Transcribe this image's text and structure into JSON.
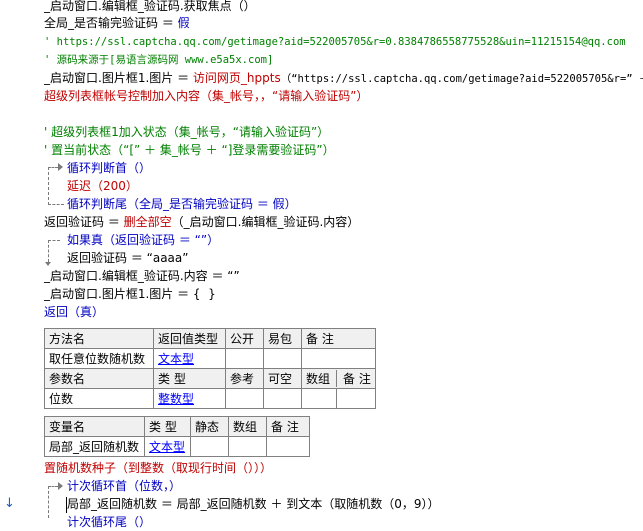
{
  "lines": {
    "l1": "_启动窗口.编辑框_验证码.获取焦点（）",
    "l2_a": "全局_是否输完验证码",
    "l2_b": " ＝ ",
    "l2_c": "假",
    "l3": "' https://ssl.captcha.qq.com/getimage?aid=522005705&r=0.8384786558775528&uin=11215154@qq.com",
    "l4": "' 源码来源于[易语言源码网 www.e5a5x.com]",
    "l5_a": "_启动窗口.图片框1.图片",
    "l5_b": " ＝ ",
    "l5_c": "访问网页_hppts",
    "l5_d": "（“https://ssl.captcha.qq.com/getimage?aid=522005705&r=” ＋",
    "l6": "超级列表框帐号控制加入内容（集_帐号，，“请输入验证码”）",
    "l7": "' 超级列表框1加入状态（集_帐号，“请输入验证码”）",
    "l8": "' 置当前状态（“[” ＋ 集_帐号 ＋ “]登录需要验证码”）",
    "l9": "循环判断首（）",
    "l10": "延迟（200）",
    "l11": "循环判断尾（全局_是否输完验证码 ＝ 假）",
    "l12_a": "返回验证码 ＝ ",
    "l12_b": "删全部空",
    "l12_c": "（_启动窗口.编辑框_验证码.内容）",
    "l13": "如果真（返回验证码 ＝ “”）",
    "l14": "返回验证码 ＝ “aaaa”",
    "l15": "_启动窗口.编辑框_验证码.内容 ＝ “”",
    "l16": "_启动窗口.图片框1.图片 ＝ {  }",
    "l17": "返回（真）",
    "l18": "置随机数种子（到整数（取现行时间（）））",
    "l19": "计次循环首（位数，）",
    "l20": "局部_返回随机数 ＝ 局部_返回随机数 ＋ 到文本（取随机数（0，9））",
    "l21": "计次循环尾（）"
  },
  "method_table": {
    "headers": [
      "方法名",
      "返回值类型",
      "公开",
      "易包",
      "备 注"
    ],
    "row": [
      "取任意位数随机数",
      "文本型",
      "",
      "",
      ""
    ]
  },
  "param_table": {
    "headers": [
      "参数名",
      "类 型",
      "参考",
      "可空",
      "数组",
      "备 注"
    ],
    "row": [
      "位数",
      "整数型",
      "",
      "",
      "",
      ""
    ]
  },
  "var_table": {
    "headers": [
      "变量名",
      "类 型",
      "静态",
      "数组",
      "备 注"
    ],
    "row": [
      "局部_返回随机数",
      "文本型",
      "",
      "",
      ""
    ]
  },
  "gutter_marker": "↓",
  "colors": {
    "keyword": "#0000c0",
    "comment": "#008000",
    "error": "#c00000",
    "table_header": "#f0f0f0"
  }
}
